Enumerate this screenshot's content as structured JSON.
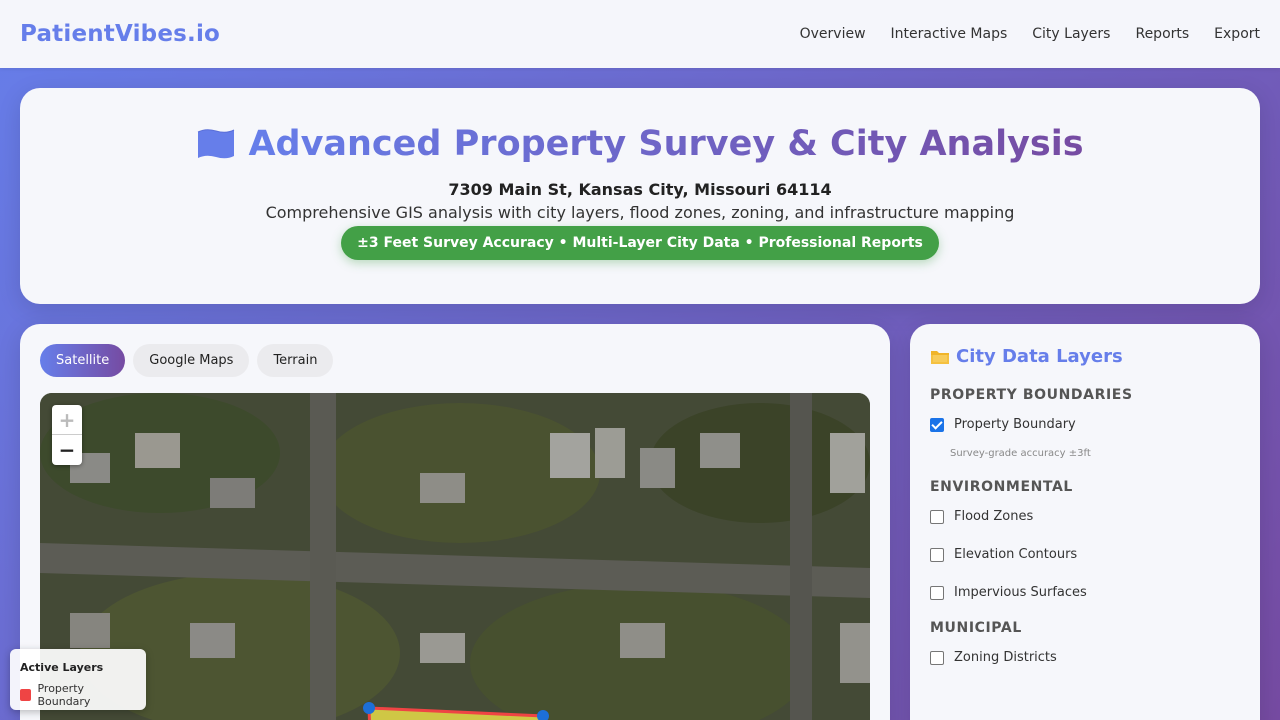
{
  "nav": {
    "brand": "PatientVibes.io",
    "links": [
      "Overview",
      "Interactive Maps",
      "City Layers",
      "Reports",
      "Export"
    ]
  },
  "hero": {
    "title": "Advanced Property Survey & City Analysis",
    "icon": "map-icon",
    "address": "7309 Main St, Kansas City, Missouri 64114",
    "subtitle": "Comprehensive GIS analysis with city layers, flood zones, zoning, and infrastructure mapping",
    "badge": "±3 Feet Survey Accuracy • Multi-Layer City Data • Professional Reports"
  },
  "map": {
    "tabs": [
      "Satellite",
      "Google Maps",
      "Terrain"
    ],
    "active_tab": "Satellite",
    "zoom_in": "+",
    "zoom_out": "−"
  },
  "legend": {
    "title": "Active Layers",
    "items": [
      {
        "label": "Property Boundary",
        "color": "#ef4444"
      }
    ]
  },
  "panel": {
    "title": "City Data Layers",
    "title_icon": "folder-icon",
    "sections": [
      {
        "title": "Property Boundaries",
        "layers": [
          {
            "label": "Property Boundary",
            "checked": true,
            "note": "Survey-grade accuracy ±3ft"
          }
        ]
      },
      {
        "title": "Environmental",
        "layers": [
          {
            "label": "Flood Zones",
            "checked": false
          },
          {
            "label": "Elevation Contours",
            "checked": false
          },
          {
            "label": "Impervious Surfaces",
            "checked": false
          }
        ]
      },
      {
        "title": "Municipal",
        "layers": [
          {
            "label": "Zoning Districts",
            "checked": false
          }
        ]
      }
    ]
  },
  "colors": {
    "brand": "#667eea",
    "gradient_end": "#764ba2",
    "badge_green": "#43a047",
    "boundary_red": "#ef4444",
    "checkbox_blue": "#1a73e8"
  }
}
